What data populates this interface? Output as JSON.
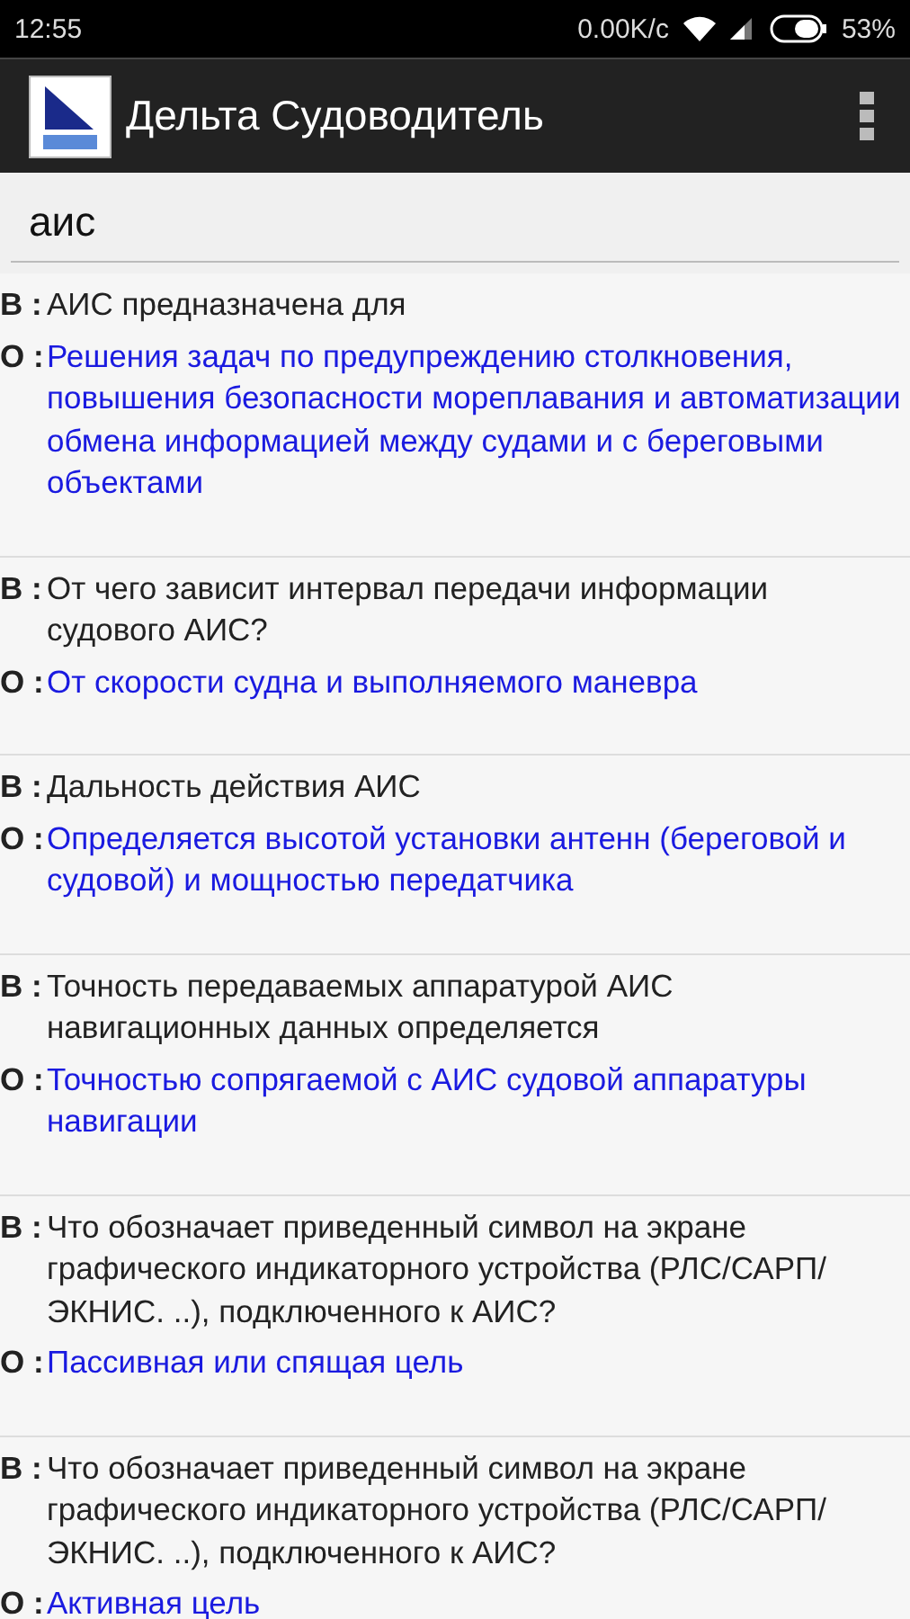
{
  "status_bar": {
    "time": "12:55",
    "net_speed": "0.00K/c",
    "battery": "53%"
  },
  "app_bar": {
    "title": "Дельта Судоводитель"
  },
  "search": {
    "value": "аис"
  },
  "results": [
    {
      "q_label": "В :",
      "question": "АИС предназначена для",
      "a_label": "О :",
      "answer": "Решения задач по предупреждению столкновения, повышения безопасности мореплавания и автоматизации обмена информацией между судами и с береговыми объектами"
    },
    {
      "q_label": "В :",
      "question": "От чего зависит интервал передачи информации судового АИС?",
      "a_label": "О :",
      "answer": "От скорости судна и выполняемого маневра"
    },
    {
      "q_label": "В :",
      "question": "Дальность действия АИС",
      "a_label": "О :",
      "answer": "Определяется высотой установки антенн (береговой и судовой) и мощностью передатчика"
    },
    {
      "q_label": "В :",
      "question": "Точность передаваемых аппаратурой АИС навигационных данных определяется",
      "a_label": "О :",
      "answer": "Точностью сопрягаемой с АИС судовой аппаратуры навигации"
    },
    {
      "q_label": "В :",
      "question": "Что обозначает приведенный символ на экране графического индикаторного устройства (РЛС/САРП/ЭКНИС. ..), подключенного к АИС?",
      "a_label": "О :",
      "answer": "Пассивная или спящая цель"
    },
    {
      "q_label": "В :",
      "question": "Что обозначает приведенный символ на экране графического индикаторного устройства (РЛС/САРП/ЭКНИС. ..), подключенного к АИС?",
      "a_label": "О :",
      "answer": "Активная цель"
    }
  ]
}
